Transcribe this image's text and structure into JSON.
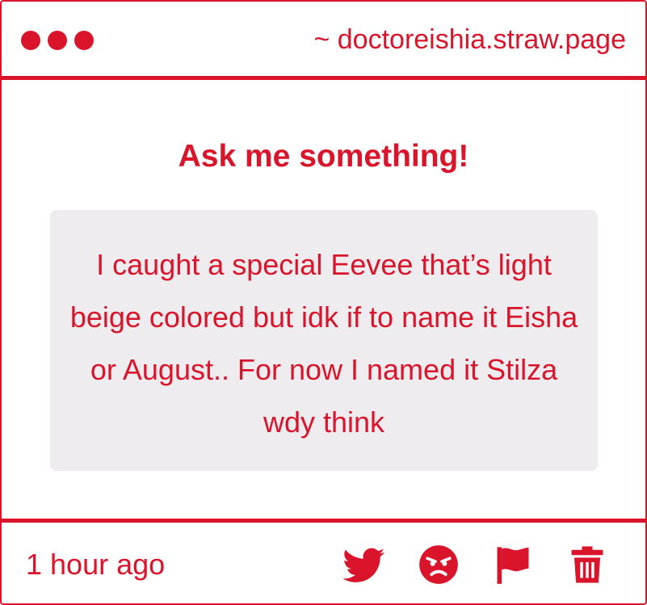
{
  "window": {
    "url": "~ doctoreishia.straw.page"
  },
  "main": {
    "title": "Ask me something!",
    "question": "I caught a special Eevee that’s light beige colored but idk if to name it Eisha or August.. For now I named it Stilza wdy think"
  },
  "footer": {
    "timestamp": "1 hour ago",
    "actions": [
      "twitter-icon",
      "angry-face-icon",
      "flag-icon",
      "trash-icon"
    ]
  },
  "colors": {
    "accent": "#d9142b",
    "box_background": "#eeecee",
    "background": "#ffffff"
  }
}
